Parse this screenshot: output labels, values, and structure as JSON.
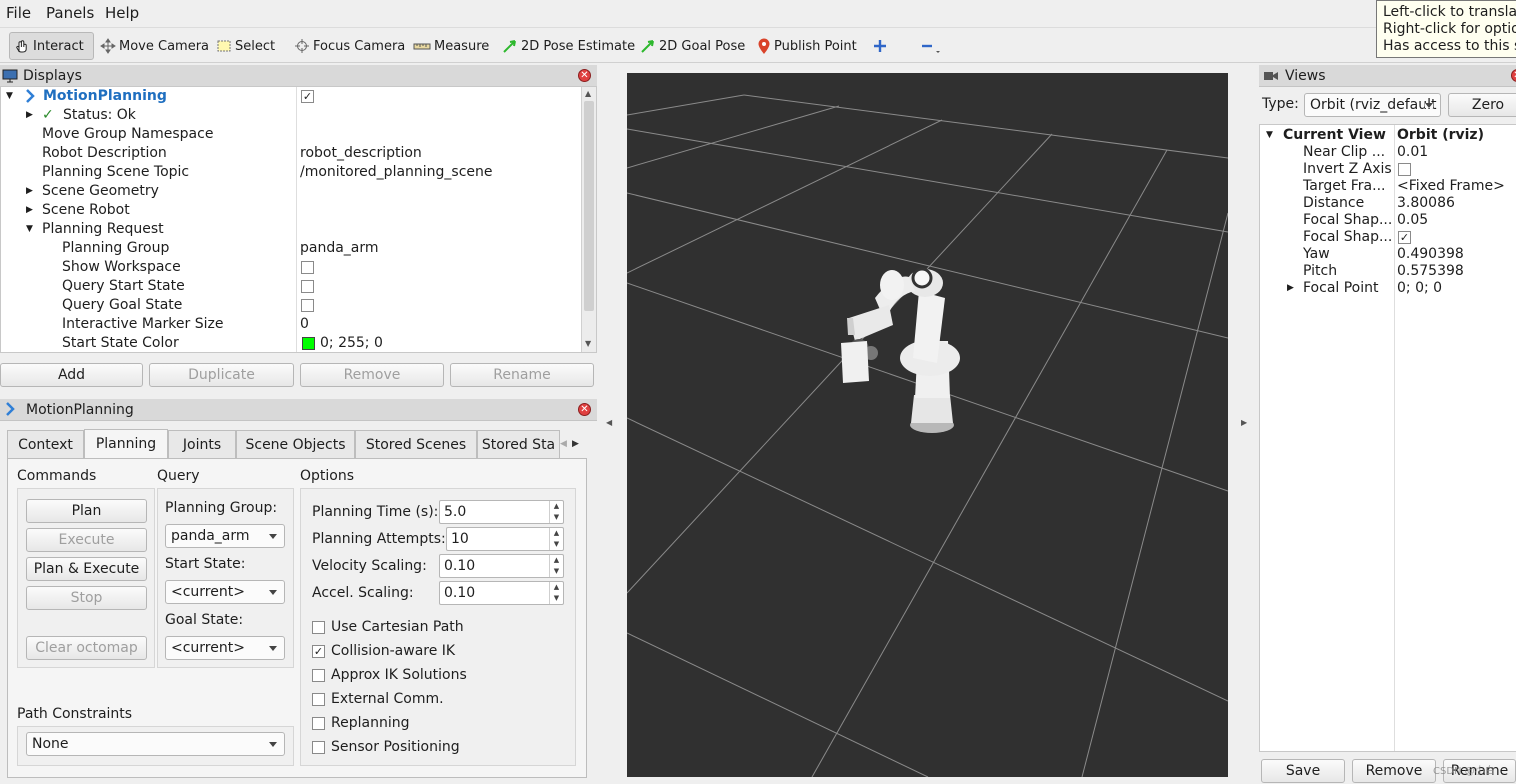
{
  "menu": {
    "file": "File",
    "panels": "Panels",
    "help": "Help"
  },
  "toolbar": {
    "interact": "Interact",
    "move_camera": "Move Camera",
    "select": "Select",
    "focus_camera": "Focus Camera",
    "measure": "Measure",
    "pose_estimate": "2D Pose Estimate",
    "goal_pose": "2D Goal Pose",
    "publish_point": "Publish Point"
  },
  "tooltip": {
    "line1": "Left-click to translate",
    "line2": "Right-click for options",
    "line3": "Has access to this size"
  },
  "displays": {
    "title": "Displays",
    "root": "MotionPlanning",
    "rows": [
      {
        "label": "Status: Ok",
        "value": ""
      },
      {
        "label": "Move Group Namespace",
        "value": ""
      },
      {
        "label": "Robot Description",
        "value": "robot_description"
      },
      {
        "label": "Planning Scene Topic",
        "value": "/monitored_planning_scene"
      },
      {
        "label": "Scene Geometry",
        "value": ""
      },
      {
        "label": "Scene Robot",
        "value": ""
      },
      {
        "label": "Planning Request",
        "value": ""
      },
      {
        "label": "Planning Group",
        "value": "panda_arm"
      },
      {
        "label": "Show Workspace",
        "value": ""
      },
      {
        "label": "Query Start State",
        "value": ""
      },
      {
        "label": "Query Goal State",
        "value": ""
      },
      {
        "label": "Interactive Marker Size",
        "value": "0"
      },
      {
        "label": "Start State Color",
        "value": "0; 255; 0"
      }
    ],
    "buttons": {
      "add": "Add",
      "duplicate": "Duplicate",
      "remove": "Remove",
      "rename": "Rename"
    }
  },
  "motion": {
    "title": "MotionPlanning",
    "tabs": [
      "Context",
      "Planning",
      "Joints",
      "Scene Objects",
      "Stored Scenes",
      "Stored Sta"
    ],
    "commands": {
      "header": "Commands",
      "plan": "Plan",
      "execute": "Execute",
      "plan_execute": "Plan & Execute",
      "stop": "Stop",
      "clear_octomap": "Clear octomap"
    },
    "query": {
      "header": "Query",
      "group_label": "Planning Group:",
      "group_value": "panda_arm",
      "start_label": "Start State:",
      "start_value": "<current>",
      "goal_label": "Goal State:",
      "goal_value": "<current>"
    },
    "options": {
      "header": "Options",
      "time_label": "Planning Time (s):",
      "time_value": "5.0",
      "attempts_label": "Planning Attempts:",
      "attempts_value": "10",
      "vel_label": "Velocity Scaling:",
      "vel_value": "0.10",
      "acc_label": "Accel. Scaling:",
      "acc_value": "0.10",
      "checks": [
        {
          "label": "Use Cartesian Path",
          "checked": false
        },
        {
          "label": "Collision-aware IK",
          "checked": true
        },
        {
          "label": "Approx IK Solutions",
          "checked": false
        },
        {
          "label": "External Comm.",
          "checked": false
        },
        {
          "label": "Replanning",
          "checked": false
        },
        {
          "label": "Sensor Positioning",
          "checked": false
        }
      ]
    },
    "path_constraints": {
      "label": "Path Constraints",
      "value": "None"
    }
  },
  "views": {
    "title": "Views",
    "type_label": "Type:",
    "type_value": "Orbit (rviz_default",
    "zero": "Zero",
    "current_view": "Current View",
    "current_value": "Orbit (rviz)",
    "props": [
      {
        "label": "Near Clip ...",
        "value": "0.01"
      },
      {
        "label": "Invert Z Axis",
        "value": ""
      },
      {
        "label": "Target Fra...",
        "value": "<Fixed Frame>"
      },
      {
        "label": "Distance",
        "value": "3.80086"
      },
      {
        "label": "Focal Shap...",
        "value": "0.05"
      },
      {
        "label": "Focal Shap...",
        "value": ""
      },
      {
        "label": "Yaw",
        "value": "0.490398"
      },
      {
        "label": "Pitch",
        "value": "0.575398"
      },
      {
        "label": "Focal Point",
        "value": "0; 0; 0"
      }
    ],
    "buttons": {
      "save": "Save",
      "remove": "Remove",
      "rename": "Rename"
    },
    "watermark": "CSDN @小白"
  },
  "colors": {
    "start_state_color": "#00ff00",
    "accent": "#1f6fc0",
    "viewport_bg": "#303030"
  }
}
